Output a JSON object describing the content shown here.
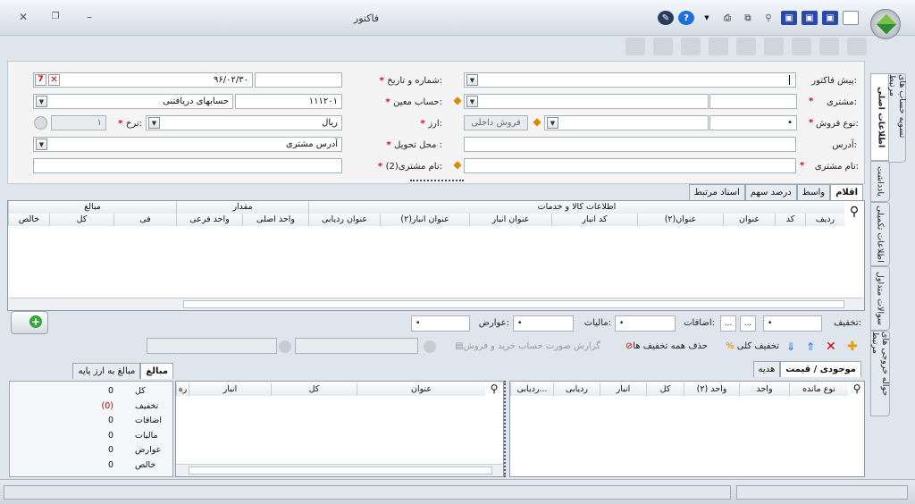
{
  "window": {
    "title": "فاکتور"
  },
  "invoice_form": {
    "pre_invoice_label": "پیش فاکتور:",
    "number_date_label": "شماره و تاریخ:",
    "date_value": "۹۶/۰۲/۳۰",
    "customer_label": "مشتری:",
    "specific_account_label": "حساب معین:",
    "account_code": "۱۱۱۲۰۱",
    "account_name": "حسابهای دریافتنی",
    "sale_type_label": "نوع فروش:",
    "sale_type_value": "فروش داخلی",
    "currency_label": "ارز:",
    "currency_value": "ریال",
    "rate_label": "نرخ:",
    "rate_value": "۱",
    "address_label": "آدرس:",
    "delivery_label": "محل تحویل :",
    "delivery_value": "آدرس مشتری",
    "customer2_label": "نام مشتری:",
    "customer2_label_right": "نام مشتری(2):"
  },
  "side_tabs": [
    "اطلاعات اصلی",
    "یادداشت",
    "تسویه حساب های مرتبط",
    "اطلاعات تکمیلی",
    "سوالات متداول",
    "حواله خروجی های مرتبط"
  ],
  "item_tabs": [
    "اقلام",
    "واسط",
    "درصد سهم",
    "اسناد مرتبط"
  ],
  "items_grid": {
    "group_headers": {
      "info": "اطلاعات کالا و خدمات",
      "qty": "مقدار",
      "amount": "مبالغ"
    },
    "columns": [
      "ردیف",
      "کد",
      "عنوان",
      "عنوان(۲)",
      "کد انبار",
      "عنوان انبار",
      "عنوان انبار(۲)",
      "عنوان ردیابی",
      "واحد اصلی",
      "واحد فرعی",
      "فی",
      "کل",
      "خالص"
    ]
  },
  "totals_row": {
    "discount_label": "تخفیف:",
    "additions_label": "اضافات:",
    "tax_label": "مالیات:",
    "duties_label": "عوارض:",
    "ellipsis": "..."
  },
  "actions": {
    "total_discount": "تخفیف کلی",
    "remove_discounts": "حذف همه تخفیف ها",
    "report": "گزارش صورت حساب خرید و فروش"
  },
  "bottom_tabs": {
    "stock": "موجودی / قیمت",
    "gift": "هدیه",
    "amounts": "مبالغ",
    "base_currency": "مبالغ به ارز پایه"
  },
  "stock_grid": {
    "columns": [
      "نوع مانده",
      "واحد",
      "واحد (۲)",
      "کل",
      "انبار",
      "ردیابی",
      "ردیابی..."
    ]
  },
  "warehouse_grid": {
    "columns": [
      "عنوان",
      "کل",
      "انبار",
      "ره"
    ]
  },
  "summary": [
    {
      "label": "کل",
      "value": "0"
    },
    {
      "label": "تخفیف",
      "value": "(0)"
    },
    {
      "label": "اضافات",
      "value": "0"
    },
    {
      "label": "مالیات",
      "value": "0"
    },
    {
      "label": "عوارض",
      "value": "0"
    },
    {
      "label": "خالص",
      "value": "0"
    }
  ],
  "colors": {
    "required": "#e2001a",
    "discount_value": "#c00000",
    "accent": "#1e6fd9"
  }
}
